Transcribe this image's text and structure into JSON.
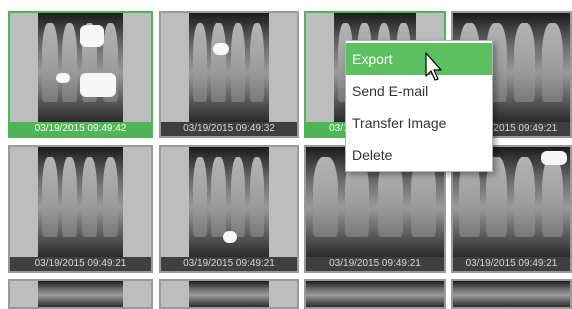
{
  "thumbnails": [
    {
      "caption": "03/19/2015 09:49:42",
      "selected": true
    },
    {
      "caption": "03/19/2015 09:49:32",
      "selected": false
    },
    {
      "caption": "03/19/2015 09:49:32",
      "selected": true
    },
    {
      "caption": "03/19/2015 09:49:21",
      "selected": false
    },
    {
      "caption": "03/19/2015 09:49:21",
      "selected": false
    },
    {
      "caption": "03/19/2015 09:49:21",
      "selected": false
    },
    {
      "caption": "03/19/2015 09:49:21",
      "selected": false
    },
    {
      "caption": "03/19/2015 09:49:21",
      "selected": false
    }
  ],
  "context_menu": {
    "items": [
      {
        "label": "Export",
        "highlighted": true
      },
      {
        "label": "Send E-mail",
        "highlighted": false
      },
      {
        "label": "Transfer Image",
        "highlighted": false
      },
      {
        "label": "Delete",
        "highlighted": false
      }
    ]
  },
  "colors": {
    "selection_green": "#4fb556",
    "menu_highlight": "#5cbf60",
    "caption_bg": "#3f3f3f"
  },
  "icons": {
    "cursor": "arrow-pointer-icon"
  }
}
